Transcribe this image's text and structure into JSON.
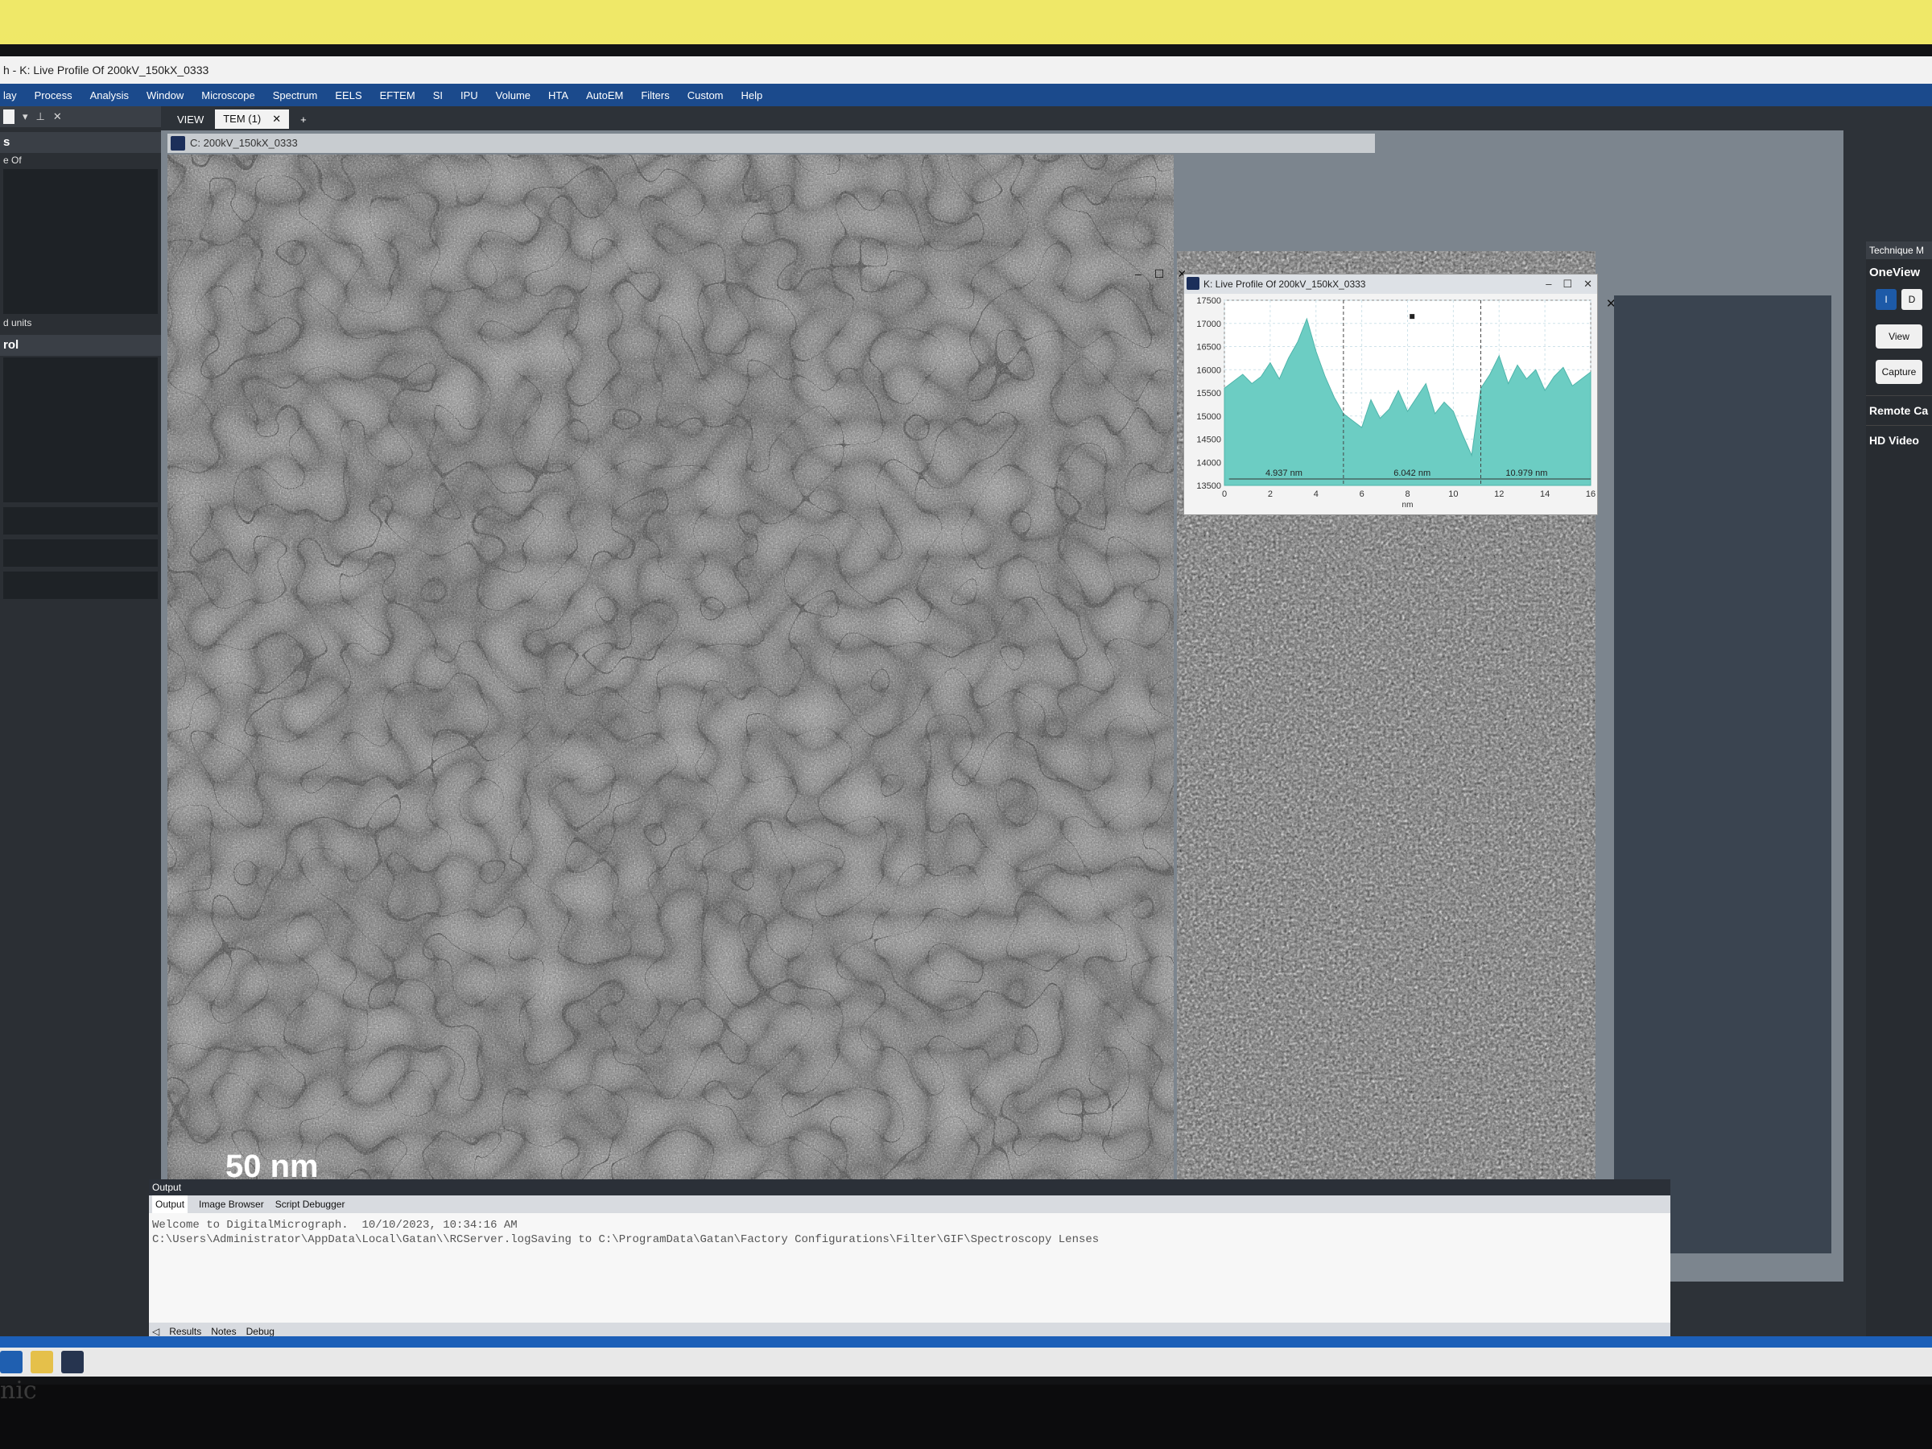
{
  "window": {
    "title": "h - K: Live Profile Of 200kV_150kX_0333"
  },
  "menu": [
    "lay",
    "Process",
    "Analysis",
    "Window",
    "Microscope",
    "Spectrum",
    "EELS",
    "EFTEM",
    "SI",
    "IPU",
    "Volume",
    "HTA",
    "AutoEM",
    "Filters",
    "Custom",
    "Help"
  ],
  "left_panel": {
    "section1": "s",
    "text1": "e Of",
    "text2": "d units",
    "section2": "rol"
  },
  "doc_tabs": {
    "view": "VIEW",
    "tem": "TEM (1)",
    "add": "+"
  },
  "image_window": {
    "title": "C: 200kV_150kX_0333",
    "scale_label": "50 nm"
  },
  "profile_window": {
    "title": "K: Live Profile Of 200kV_150kX_0333",
    "y_ticks": [
      "17500",
      "17000",
      "16500",
      "16000",
      "15500",
      "15000",
      "14500",
      "14000",
      "13500"
    ],
    "x_ticks": [
      "0",
      "2",
      "4",
      "6",
      "8",
      "10",
      "12",
      "14",
      "16"
    ],
    "xlabel": "nm",
    "annotations": [
      "4.937 nm",
      "6.042 nm",
      "10.979 nm"
    ]
  },
  "chart_data": {
    "type": "area",
    "xlabel": "nm",
    "ylim": [
      13500,
      17500
    ],
    "xlim": [
      0,
      16
    ],
    "x": [
      0.0,
      0.4,
      0.8,
      1.2,
      1.6,
      2.0,
      2.4,
      2.8,
      3.2,
      3.6,
      4.0,
      4.4,
      4.8,
      5.2,
      5.6,
      6.0,
      6.4,
      6.8,
      7.2,
      7.6,
      8.0,
      8.4,
      8.8,
      9.2,
      9.6,
      10.0,
      10.4,
      10.8,
      11.2,
      11.6,
      12.0,
      12.4,
      12.8,
      13.2,
      13.6,
      14.0,
      14.4,
      14.8,
      15.2,
      15.6,
      16.0
    ],
    "y": [
      15600,
      15750,
      15900,
      15700,
      15850,
      16150,
      15800,
      16250,
      16600,
      17100,
      16400,
      15850,
      15400,
      15050,
      14900,
      14750,
      15350,
      14950,
      15150,
      15550,
      15100,
      15400,
      15700,
      15050,
      15300,
      15100,
      14600,
      14150,
      15600,
      15900,
      16300,
      15700,
      16100,
      15800,
      16000,
      15550,
      15850,
      16050,
      15650,
      15800,
      15950
    ],
    "annotations": [
      "4.937 nm",
      "6.042 nm",
      "10.979 nm"
    ]
  },
  "right_panel": {
    "header": "Technique M",
    "oneview": "OneView",
    "toggle_i": "I",
    "toggle_d": "D",
    "view_btn": "View",
    "capture_btn": "Capture",
    "remote": "Remote Ca",
    "hd_video": "HD Video"
  },
  "output": {
    "header": "Output",
    "tabs": [
      "Output",
      "Image Browser",
      "Script Debugger"
    ],
    "lines": [
      "Welcome to DigitalMicrograph.  10/10/2023, 10:34:16 AM",
      "C:\\Users\\Administrator\\AppData\\Local\\Gatan\\\\RCServer.logSaving to C:\\ProgramData\\Gatan\\Factory Configurations\\Filter\\GIF\\Spectroscopy Lenses"
    ],
    "bottom_tabs": [
      "Results",
      "Notes",
      "Debug"
    ]
  },
  "colors": {
    "menubar": "#1b4a8c",
    "profile_fill": "#6ccdc3",
    "statusbar": "#1c5fb8"
  },
  "bezel_brand": "nic"
}
